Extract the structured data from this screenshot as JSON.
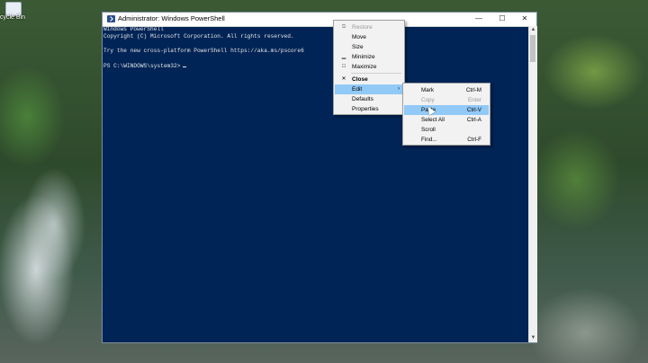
{
  "desktop": {
    "recycle_bin_label": "cycle Bin"
  },
  "window": {
    "title": "Administrator: Windows PowerShell",
    "controls": {
      "minimize": "—",
      "maximize": "☐",
      "close": "✕"
    }
  },
  "console": {
    "lines": [
      "Windows PowerShell",
      "Copyright (C) Microsoft Corporation. All rights reserved.",
      "",
      "Try the new cross-platform PowerShell https://aka.ms/pscore6",
      "",
      "PS C:\\WINDOWS\\system32>"
    ]
  },
  "system_menu": {
    "items": [
      {
        "label": "Restore",
        "icon": "restore-icon",
        "glyph": "⧉",
        "disabled": true
      },
      {
        "label": "Move",
        "icon": "",
        "glyph": "",
        "disabled": false
      },
      {
        "label": "Size",
        "icon": "",
        "glyph": "",
        "disabled": false
      },
      {
        "label": "Minimize",
        "icon": "minimize-icon",
        "glyph": "▁",
        "disabled": false
      },
      {
        "label": "Maximize",
        "icon": "maximize-icon",
        "glyph": "□",
        "disabled": false
      },
      {
        "label": "Close",
        "icon": "close-icon",
        "glyph": "✕",
        "disabled": false,
        "bold": true
      },
      {
        "label": "Edit",
        "icon": "",
        "glyph": "",
        "disabled": false,
        "highlight": true,
        "submenu_arrow": "›"
      },
      {
        "label": "Defaults",
        "icon": "",
        "glyph": "",
        "disabled": false
      },
      {
        "label": "Properties",
        "icon": "",
        "glyph": "",
        "disabled": false
      }
    ]
  },
  "edit_submenu": {
    "items": [
      {
        "label": "Mark",
        "shortcut": "Ctrl-M",
        "disabled": false
      },
      {
        "label": "Copy",
        "shortcut": "Enter",
        "disabled": true
      },
      {
        "label": "Paste",
        "shortcut": "Ctrl-V",
        "disabled": false,
        "highlight": true
      },
      {
        "label": "Select All",
        "shortcut": "Ctrl-A",
        "disabled": false
      },
      {
        "label": "Scroll",
        "shortcut": "",
        "disabled": false
      },
      {
        "label": "Find...",
        "shortcut": "Ctrl-F",
        "disabled": false
      }
    ]
  },
  "colors": {
    "console_background": "#012456",
    "console_text": "#e6e6e6",
    "menu_highlight": "#91c9f7"
  }
}
